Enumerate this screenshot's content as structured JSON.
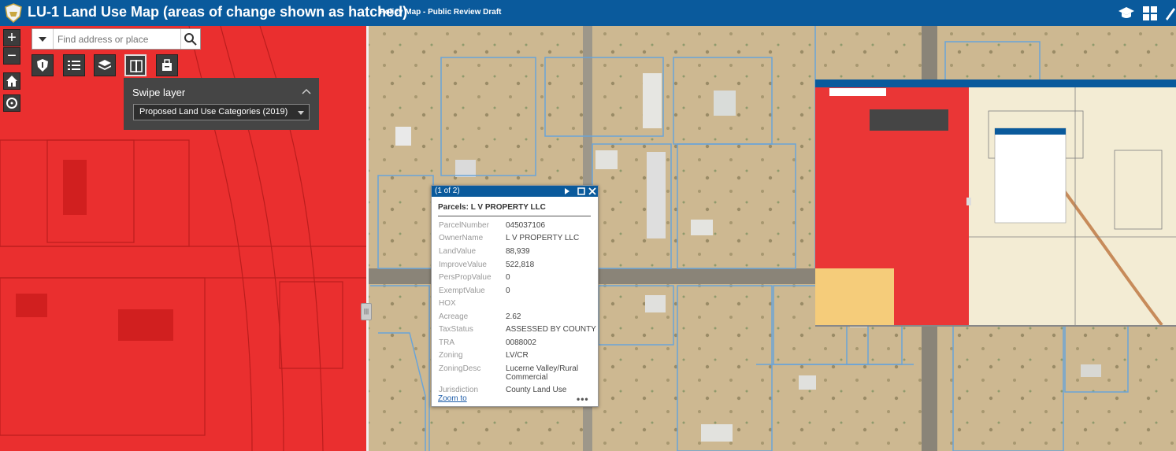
{
  "header": {
    "title": "LU-1 Land Use Map (areas of change shown as hatched)",
    "subtitle": "Policy Map - Public Review Draft"
  },
  "map_controls": {
    "zoom_in_label": "+",
    "zoom_out_label": "−"
  },
  "search": {
    "placeholder": "Find address or place"
  },
  "toolbar": {
    "icons": [
      "shield-icon",
      "legend-list-icon",
      "layers-icon",
      "swipe-icon",
      "print-icon"
    ],
    "active": "swipe-icon"
  },
  "swipe_panel": {
    "title": "Swipe layer",
    "selected_layer": "Proposed Land Use Categories (2019)"
  },
  "popup": {
    "count": "(1 of 2)",
    "title": "Parcels: L V PROPERTY LLC",
    "fields": [
      {
        "label": "ParcelNumber",
        "value": "045037106"
      },
      {
        "label": "OwnerName",
        "value": "L V PROPERTY LLC"
      },
      {
        "label": "LandValue",
        "value": "88,939"
      },
      {
        "label": "ImproveValue",
        "value": "522,818"
      },
      {
        "label": "PersPropValue",
        "value": "0"
      },
      {
        "label": "ExemptValue",
        "value": "0"
      },
      {
        "label": "HOX",
        "value": ""
      },
      {
        "label": "Acreage",
        "value": "2.62"
      },
      {
        "label": "TaxStatus",
        "value": "ASSESSED BY COUNTY"
      },
      {
        "label": "TRA",
        "value": "0088002"
      },
      {
        "label": "Zoning",
        "value": "LV/CR"
      },
      {
        "label": "ZoningDesc",
        "value": "Lucerne Valley/Rural Commercial"
      },
      {
        "label": "Jurisdiction",
        "value": "County Land Use"
      }
    ],
    "zoom_link": "Zoom to",
    "more_label": "•••"
  },
  "colors": {
    "header_bg": "#0a5a9c",
    "land_use_red": "#ea2f2f",
    "panel_bg": "#454545",
    "parcel_line": "#6aa4d8"
  }
}
